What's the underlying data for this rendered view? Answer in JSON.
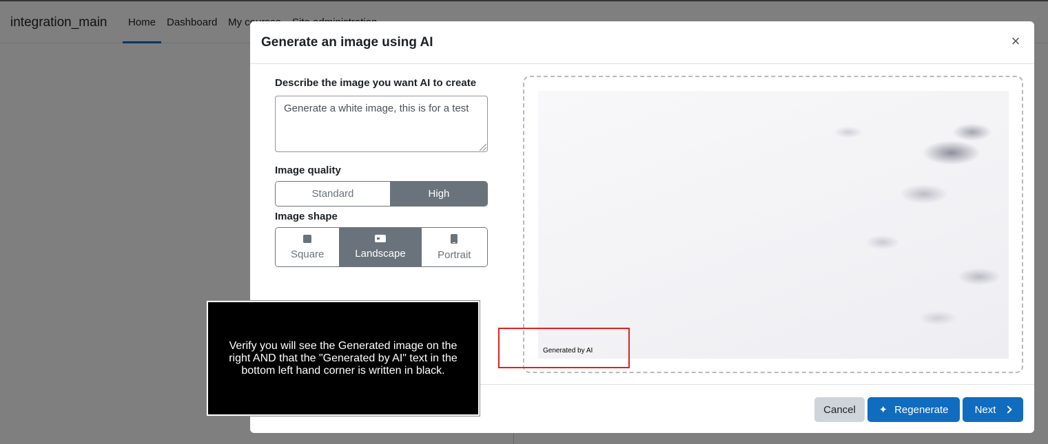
{
  "navbar": {
    "site_name": "integration_main",
    "items": [
      "Home",
      "Dashboard",
      "My courses",
      "Site administration"
    ]
  },
  "modal": {
    "title": "Generate an image using AI",
    "close_label": "×",
    "prompt": {
      "label": "Describe the image you want AI to create",
      "value": "Generate a white image, this is for a test"
    },
    "quality": {
      "label": "Image quality",
      "options": [
        "Standard",
        "High"
      ],
      "selected": "High"
    },
    "shape": {
      "label": "Image shape",
      "options": [
        "Square",
        "Landscape",
        "Portrait"
      ],
      "selected": "Landscape"
    },
    "preview": {
      "watermark": "Generated by AI"
    },
    "footer": {
      "cancel_label": "Cancel",
      "regenerate_label": "Regenerate",
      "next_label": "Next"
    }
  },
  "overlay": {
    "instruction": "Verify you will see the Generated image on the right AND that the \"Generated by AI\" text in the bottom left hand corner is written in black."
  },
  "colors": {
    "primary": "#0f6cbf",
    "secondary": "#6a737b",
    "cancel_bg": "#ced4da",
    "highlight": "#e02020"
  }
}
